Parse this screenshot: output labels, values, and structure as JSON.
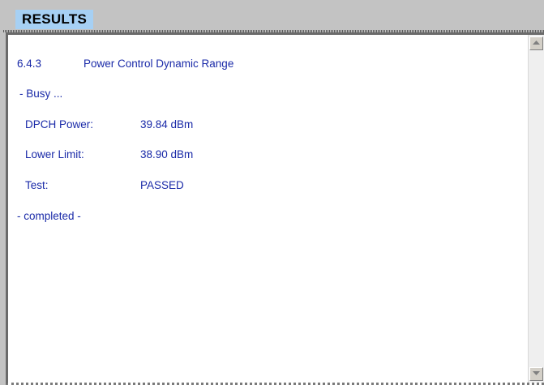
{
  "window": {
    "title": "RESULTS"
  },
  "results": {
    "test_number": "6.4.3",
    "test_name": "Power Control Dynamic Range",
    "busy_text": "- Busy ...",
    "rows": [
      {
        "label": "DPCH Power:",
        "value": "39.84 dBm"
      },
      {
        "label": "Lower Limit:",
        "value": "38.90 dBm"
      },
      {
        "label": "Test:",
        "value": "PASSED"
      }
    ],
    "completed_text": "- completed -"
  },
  "scrollbar": {
    "up_icon": "arrow-up-icon",
    "down_icon": "arrow-down-icon"
  },
  "colors": {
    "text": "#1a2aa8",
    "title_bg": "#a6d0f4",
    "window_bg": "#c3c3c3"
  }
}
